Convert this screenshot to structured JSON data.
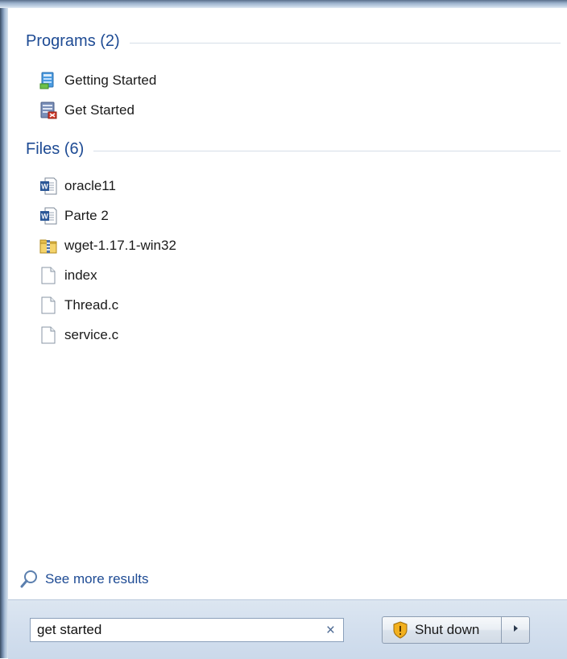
{
  "results": {
    "programs": {
      "title": "Programs (2)",
      "items": [
        {
          "label": "Getting Started",
          "icon": "getting-started-icon"
        },
        {
          "label": "Get Started",
          "icon": "get-started-app-icon"
        }
      ]
    },
    "files": {
      "title": "Files (6)",
      "items": [
        {
          "label": "oracle11",
          "icon": "word-document-icon"
        },
        {
          "label": "Parte 2",
          "icon": "word-document-icon"
        },
        {
          "label": "wget-1.17.1-win32",
          "icon": "zip-folder-icon"
        },
        {
          "label": "index",
          "icon": "blank-file-icon"
        },
        {
          "label": "Thread.c",
          "icon": "blank-file-icon"
        },
        {
          "label": "service.c",
          "icon": "blank-file-icon"
        }
      ]
    },
    "see_more_label": "See more results"
  },
  "search": {
    "value": "get started",
    "clear_glyph": "×"
  },
  "power": {
    "shutdown_label": "Shut down"
  },
  "colors": {
    "accent": "#1e4b94",
    "bottom_bar": "#d3dfee"
  }
}
